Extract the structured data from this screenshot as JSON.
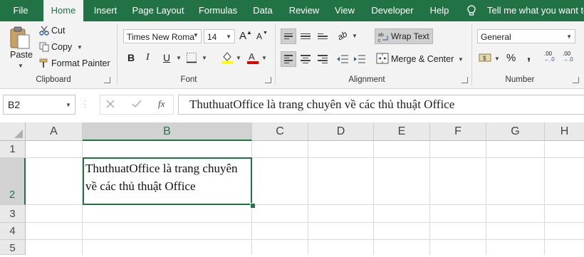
{
  "ribbon_tabs": [
    "File",
    "Home",
    "Insert",
    "Page Layout",
    "Formulas",
    "Data",
    "Review",
    "View",
    "Developer",
    "Help"
  ],
  "tell_me": "Tell me what you want to",
  "clipboard": {
    "paste": "Paste",
    "cut": "Cut",
    "copy": "Copy",
    "format_painter": "Format Painter",
    "label": "Clipboard"
  },
  "font": {
    "name": "Times New Roma",
    "size": "14",
    "grow": "A",
    "shrink": "A",
    "bold": "B",
    "italic": "I",
    "underline": "U",
    "label": "Font",
    "fill_color": "#ffff00",
    "font_color": "#e00000"
  },
  "alignment": {
    "wrap_text": "Wrap Text",
    "merge_center": "Merge & Center",
    "label": "Alignment",
    "orientation_icon": "ab"
  },
  "number": {
    "format": "General",
    "currency": "$",
    "percent": "%",
    "comma": ",",
    "increase_decimal": ".00",
    "decrease_decimal": ".00",
    "label": "Number"
  },
  "formula_bar": {
    "name_box": "B2",
    "fx": "fx",
    "content": "ThuthuatOffice là trang chuyên về các thủ thuật Office"
  },
  "columns": [
    "A",
    "B",
    "C",
    "D",
    "E",
    "F",
    "G",
    "H"
  ],
  "rows": [
    "1",
    "2",
    "3",
    "4",
    "5"
  ],
  "cell_b2": {
    "line1": "ThuthuatOffice là trang chuyên",
    "line2": "về các thủ thuật Office"
  },
  "colors": {
    "accent": "#217346"
  }
}
